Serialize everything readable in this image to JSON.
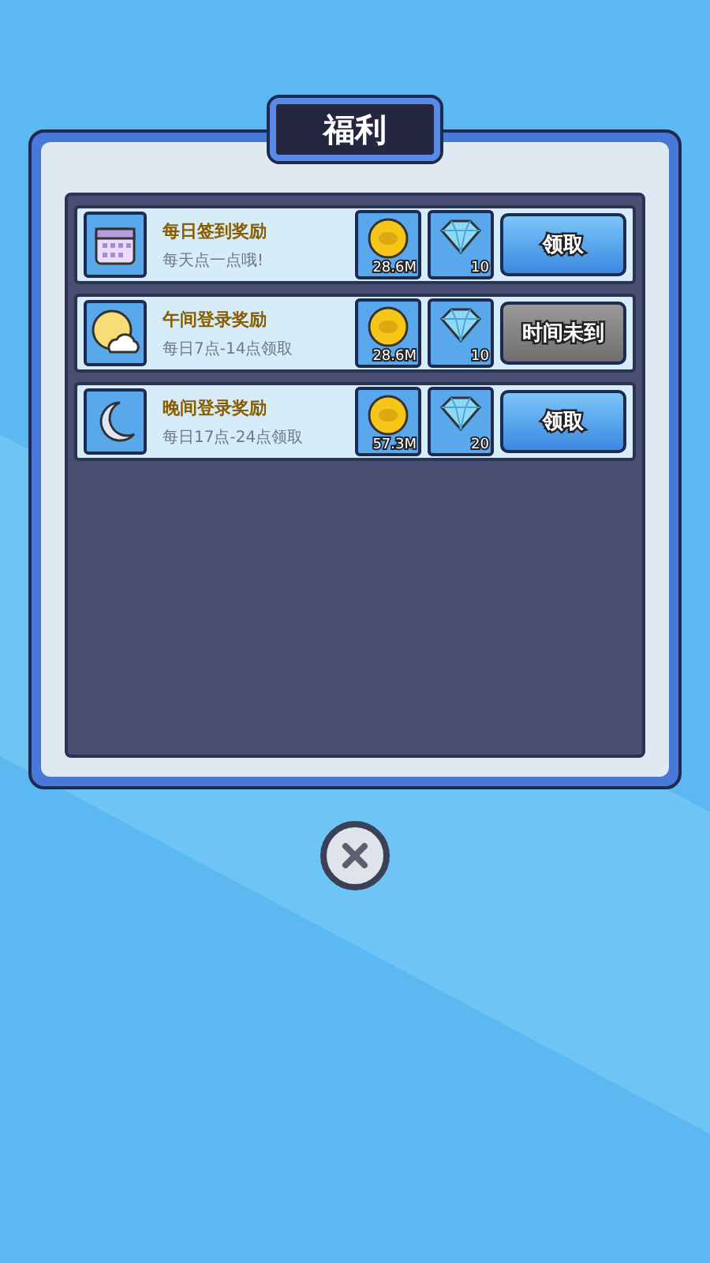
{
  "dialog": {
    "title": "福利"
  },
  "rewards": [
    {
      "kind": "calendar",
      "title": "每日签到奖励",
      "subtitle": "每天点一点哦!",
      "coins": "28.6M",
      "gems": "10",
      "button": "领取",
      "available": true
    },
    {
      "kind": "sun",
      "title": "午间登录奖励",
      "subtitle": "每日7点-14点领取",
      "coins": "28.6M",
      "gems": "10",
      "button": "时间未到",
      "available": false
    },
    {
      "kind": "moon",
      "title": "晚间登录奖励",
      "subtitle": "每日17点-24点领取",
      "coins": "57.3M",
      "gems": "20",
      "button": "领取",
      "available": true
    }
  ]
}
